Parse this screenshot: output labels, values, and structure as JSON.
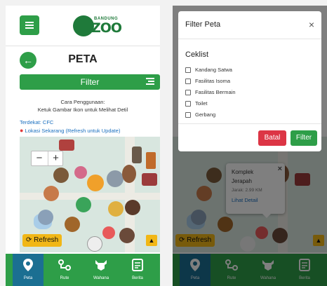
{
  "header": {
    "logo_small": "BANDUNG",
    "logo_big": "ZOO"
  },
  "page": {
    "title": "PETA",
    "filter_label": "Filter",
    "howto_title": "Cara Penggunaan:",
    "howto_text": "Ketuk Gambar Ikon untuk Melihat Detil",
    "nearest": "Terdekat: CFC",
    "location": "Lokasi Sekarang (Refresh untuk Update)"
  },
  "map": {
    "zoom_in": "+",
    "zoom_out": "−",
    "refresh_label": "Refresh",
    "up_icon": "chevron-up-icon"
  },
  "popup": {
    "name_line1": "Komplek",
    "name_line2": "Jerapah",
    "distance": "Jarak: 2.99 KM",
    "link": "Lihat Detail",
    "close": "×"
  },
  "nav": {
    "items": [
      {
        "label": "Peta",
        "icon": "map-pin-icon",
        "active": true
      },
      {
        "label": "Rute",
        "icon": "route-icon",
        "active": false
      },
      {
        "label": "Wahana",
        "icon": "animal-head-icon",
        "active": false
      },
      {
        "label": "Berita",
        "icon": "news-icon",
        "active": false
      }
    ]
  },
  "modal": {
    "title": "Filter Peta",
    "close": "×",
    "section": "Ceklist",
    "options": [
      "Kandang Satwa",
      "Fasilitas Isoma",
      "Fasilitas Bermain",
      "Toilet",
      "Gerbang"
    ],
    "cancel_label": "Batal",
    "apply_label": "Filter"
  },
  "colors": {
    "primary": "#2e9e48",
    "active_nav": "#1b6f92",
    "link": "#1a6fbf",
    "danger": "#dc3545",
    "accent": "#f1b716"
  }
}
